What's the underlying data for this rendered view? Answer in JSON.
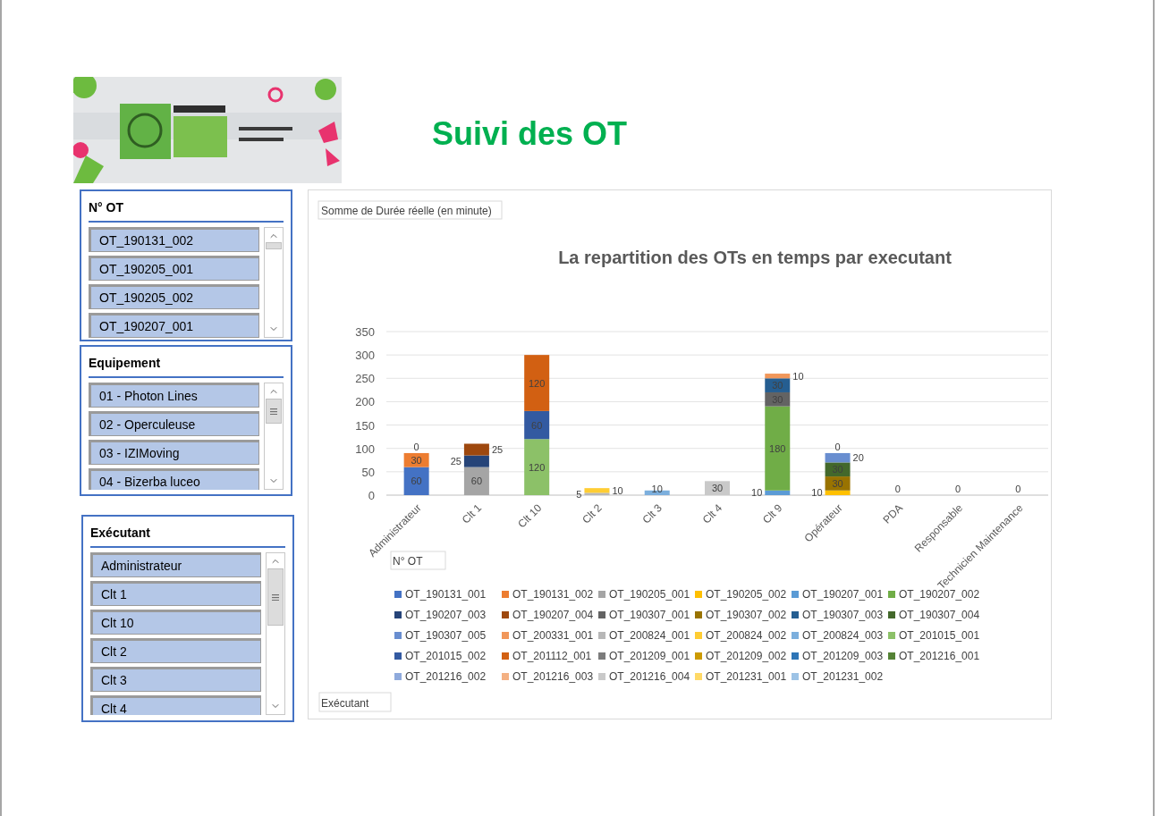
{
  "title": "Suivi des OT",
  "slicers": [
    {
      "title": "N° OT",
      "items": [
        {
          "label": "OT_190131_002",
          "selected": true
        },
        {
          "label": "OT_190205_001",
          "selected": true
        },
        {
          "label": "OT_190205_002",
          "selected": true
        },
        {
          "label": "OT_190207_001",
          "selected": true
        }
      ]
    },
    {
      "title": "Equipement",
      "items": [
        {
          "label": "01 - Photon Lines",
          "selected": true
        },
        {
          "label": "02 - Operculeuse",
          "selected": true
        },
        {
          "label": "03 - IZIMoving",
          "selected": true
        },
        {
          "label": "04 - Bizerba luceo",
          "selected": true
        }
      ]
    },
    {
      "title": "Exécutant",
      "items": [
        {
          "label": "Administrateur",
          "selected": true
        },
        {
          "label": "Clt 1",
          "selected": true
        },
        {
          "label": "Clt 10",
          "selected": true
        },
        {
          "label": "Clt 2",
          "selected": true
        },
        {
          "label": "Clt 3",
          "selected": true
        },
        {
          "label": "Clt 4",
          "selected": true
        }
      ]
    }
  ],
  "chart": {
    "value_field_button": "Somme de Durée réelle (en minute)",
    "legend_field_button": "N° OT",
    "axis_field_button": "Exécutant",
    "chart_data": {
      "type": "bar",
      "stacked": true,
      "grid": true,
      "legend": true,
      "title": "La repartition des OTs en temps par executant",
      "data_labels": true,
      "categories": [
        "Administrateur",
        "Clt 1",
        "Clt 10",
        "Clt 2",
        "Clt 3",
        "Clt 4",
        "Clt 9",
        "Opérateur",
        "PDA",
        "Responsable",
        "Technicien Maintenance"
      ],
      "ylim": [
        0,
        350
      ],
      "yticks": [
        0,
        50,
        100,
        150,
        200,
        250,
        300,
        350
      ],
      "series": [
        {
          "name": "OT_190131_001",
          "color": "#4472c4",
          "values": [
            60,
            null,
            null,
            null,
            null,
            null,
            null,
            null,
            null,
            null,
            null
          ]
        },
        {
          "name": "OT_190131_002",
          "color": "#ed7d31",
          "values": [
            30,
            null,
            null,
            null,
            null,
            null,
            null,
            null,
            null,
            null,
            null
          ]
        },
        {
          "name": "OT_190205_001",
          "color": "#a5a5a5",
          "values": [
            null,
            60,
            null,
            null,
            null,
            null,
            null,
            null,
            null,
            null,
            null
          ]
        },
        {
          "name": "OT_190205_002",
          "color": "#ffc000",
          "values": [
            null,
            null,
            null,
            null,
            null,
            null,
            null,
            10,
            null,
            null,
            null
          ]
        },
        {
          "name": "OT_190207_001",
          "color": "#5b9bd5",
          "values": [
            null,
            null,
            null,
            null,
            null,
            null,
            10,
            null,
            null,
            null,
            null
          ]
        },
        {
          "name": "OT_190207_002",
          "color": "#70ad47",
          "values": [
            null,
            null,
            null,
            null,
            null,
            null,
            180,
            null,
            null,
            null,
            null
          ]
        },
        {
          "name": "OT_190207_003",
          "color": "#264478",
          "values": [
            null,
            25,
            null,
            null,
            null,
            null,
            null,
            null,
            null,
            null,
            null
          ]
        },
        {
          "name": "OT_190207_004",
          "color": "#9e480e",
          "values": [
            null,
            25,
            null,
            null,
            null,
            null,
            null,
            null,
            null,
            null,
            null
          ]
        },
        {
          "name": "OT_190307_001",
          "color": "#636363",
          "values": [
            null,
            null,
            null,
            null,
            null,
            null,
            30,
            null,
            null,
            null,
            null
          ]
        },
        {
          "name": "OT_190307_002",
          "color": "#997300",
          "values": [
            null,
            null,
            null,
            null,
            null,
            null,
            null,
            30,
            null,
            null,
            null
          ]
        },
        {
          "name": "OT_190307_003",
          "color": "#255e91",
          "values": [
            null,
            null,
            null,
            null,
            null,
            null,
            30,
            null,
            null,
            null,
            null
          ]
        },
        {
          "name": "OT_190307_004",
          "color": "#43682b",
          "values": [
            null,
            null,
            null,
            null,
            null,
            null,
            null,
            30,
            null,
            null,
            null
          ]
        },
        {
          "name": "OT_190307_005",
          "color": "#698ed0",
          "values": [
            null,
            null,
            null,
            null,
            null,
            null,
            null,
            20,
            null,
            null,
            null
          ]
        },
        {
          "name": "OT_200331_001",
          "color": "#f1975a",
          "values": [
            null,
            null,
            null,
            null,
            null,
            null,
            10,
            null,
            null,
            null,
            null
          ]
        },
        {
          "name": "OT_200824_001",
          "color": "#b7b7b7",
          "values": [
            null,
            null,
            null,
            5,
            null,
            null,
            null,
            null,
            null,
            null,
            null
          ]
        },
        {
          "name": "OT_200824_002",
          "color": "#ffcd33",
          "values": [
            null,
            null,
            null,
            10,
            null,
            null,
            null,
            null,
            null,
            null,
            null
          ]
        },
        {
          "name": "OT_200824_003",
          "color": "#7cafdd",
          "values": [
            null,
            null,
            null,
            null,
            10,
            null,
            null,
            null,
            null,
            null,
            null
          ]
        },
        {
          "name": "OT_201015_001",
          "color": "#8cc168",
          "values": [
            null,
            null,
            120,
            null,
            null,
            null,
            null,
            null,
            null,
            null,
            null
          ]
        },
        {
          "name": "OT_201015_002",
          "color": "#335aa1",
          "values": [
            null,
            null,
            60,
            null,
            null,
            null,
            null,
            null,
            null,
            null,
            null
          ]
        },
        {
          "name": "OT_201112_001",
          "color": "#d26012",
          "values": [
            null,
            null,
            120,
            null,
            null,
            null,
            null,
            null,
            null,
            null,
            null
          ]
        },
        {
          "name": "OT_201209_001",
          "color": "#7c7c7c",
          "values": [
            null,
            null,
            null,
            null,
            null,
            null,
            null,
            null,
            0,
            null,
            null
          ]
        },
        {
          "name": "OT_201209_002",
          "color": "#cc9a00",
          "values": [
            null,
            null,
            null,
            null,
            null,
            null,
            null,
            null,
            null,
            0,
            null
          ]
        },
        {
          "name": "OT_201209_003",
          "color": "#2e75b6",
          "values": [
            null,
            null,
            null,
            null,
            null,
            null,
            null,
            null,
            null,
            null,
            0
          ]
        },
        {
          "name": "OT_201216_001",
          "color": "#548235",
          "values": [
            null,
            null,
            null,
            null,
            null,
            null,
            null,
            0,
            null,
            null,
            null
          ]
        },
        {
          "name": "OT_201216_002",
          "color": "#8faadc",
          "values": [
            0,
            null,
            null,
            null,
            null,
            null,
            null,
            null,
            null,
            null,
            null
          ]
        },
        {
          "name": "OT_201216_003",
          "color": "#f4b183",
          "values": [
            null,
            null,
            null,
            null,
            null,
            null,
            null,
            null,
            null,
            null,
            null
          ]
        },
        {
          "name": "OT_201216_004",
          "color": "#c9c9c9",
          "values": [
            null,
            null,
            null,
            null,
            null,
            30,
            null,
            null,
            null,
            null,
            null
          ]
        },
        {
          "name": "OT_201231_001",
          "color": "#ffd966",
          "values": [
            null,
            null,
            null,
            null,
            null,
            null,
            null,
            null,
            null,
            null,
            null
          ]
        },
        {
          "name": "OT_201231_002",
          "color": "#9dc3e6",
          "values": [
            null,
            null,
            null,
            null,
            null,
            null,
            null,
            null,
            null,
            null,
            null
          ]
        }
      ]
    }
  }
}
